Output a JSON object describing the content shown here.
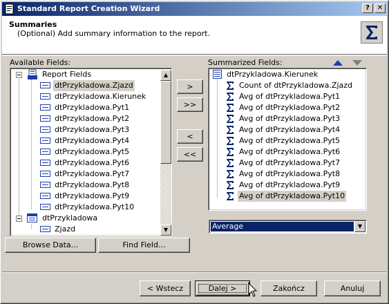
{
  "window": {
    "title": "Standard Report Creation Wizard",
    "help_button": "?",
    "close_button": "✕"
  },
  "header": {
    "title": "Summaries",
    "subtitle": "(Optional) Add summary information to the report."
  },
  "available": {
    "label": "Available Fields:",
    "root": "Report Fields",
    "fields": [
      "dtPrzykladowa.Zjazd",
      "dtPrzykladowa.Kierunek",
      "dtPrzykladowa.Pyt1",
      "dtPrzykladowa.Pyt2",
      "dtPrzykladowa.Pyt3",
      "dtPrzykladowa.Pyt4",
      "dtPrzykladowa.Pyt5",
      "dtPrzykladowa.Pyt6",
      "dtPrzykladowa.Pyt7",
      "dtPrzykladowa.Pyt8",
      "dtPrzykladowa.Pyt9",
      "dtPrzykladowa.Pyt10"
    ],
    "table": "dtPrzykladowa",
    "table_child": "Zjazd",
    "selected": "dtPrzykladowa.Zjazd"
  },
  "move_buttons": {
    "add": ">",
    "add_all": ">>",
    "remove": "<",
    "remove_all": "<<"
  },
  "summarized": {
    "label": "Summarized Fields:",
    "group": "dtPrzykladowa.Kierunek",
    "items": [
      "Count of dtPrzykladowa.Zjazd",
      "Avg of dtPrzykladowa.Pyt1",
      "Avg of dtPrzykladowa.Pyt2",
      "Avg of dtPrzykladowa.Pyt3",
      "Avg of dtPrzykladowa.Pyt4",
      "Avg of dtPrzykladowa.Pyt5",
      "Avg of dtPrzykladowa.Pyt6",
      "Avg of dtPrzykladowa.Pyt7",
      "Avg of dtPrzykladowa.Pyt8",
      "Avg of dtPrzykladowa.Pyt9",
      "Avg of dtPrzykladowa.Pyt10"
    ],
    "selected": "Avg of dtPrzykladowa.Pyt10"
  },
  "summary_type": {
    "value": "Average"
  },
  "buttons": {
    "browse": "Browse Data...",
    "find": "Find Field...",
    "back": "< Wstecz",
    "next": "Dalej >",
    "finish": "Zakończ",
    "cancel": "Anuluj"
  },
  "colors": {
    "titlebar_start": "#0a246a",
    "titlebar_end": "#a6caf0",
    "selection": "#0a246a",
    "sigma": "#0a246a",
    "arrow_up": "#1c3ca8",
    "arrow_down": "#808080"
  }
}
